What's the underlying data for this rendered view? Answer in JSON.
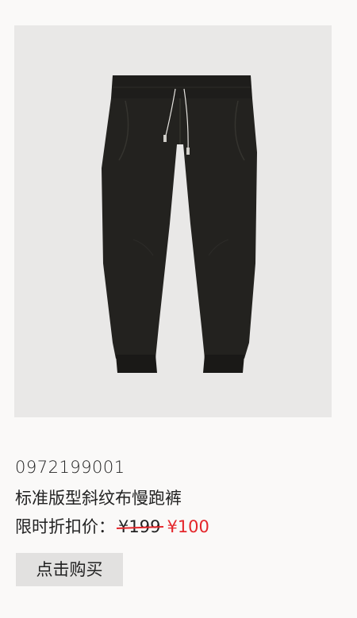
{
  "product": {
    "sku": "0972199001",
    "name": "标准版型斜纹布慢跑裤",
    "price_label": "限时折扣价：",
    "original_price": "¥199",
    "sale_price": "¥100",
    "image_alt": "black-jogger-pants",
    "colors": {
      "sale": "#e4262b",
      "image_bg": "#e9e8e7",
      "button_bg": "#e2e1e0"
    }
  },
  "actions": {
    "buy_label": "点击购买"
  }
}
